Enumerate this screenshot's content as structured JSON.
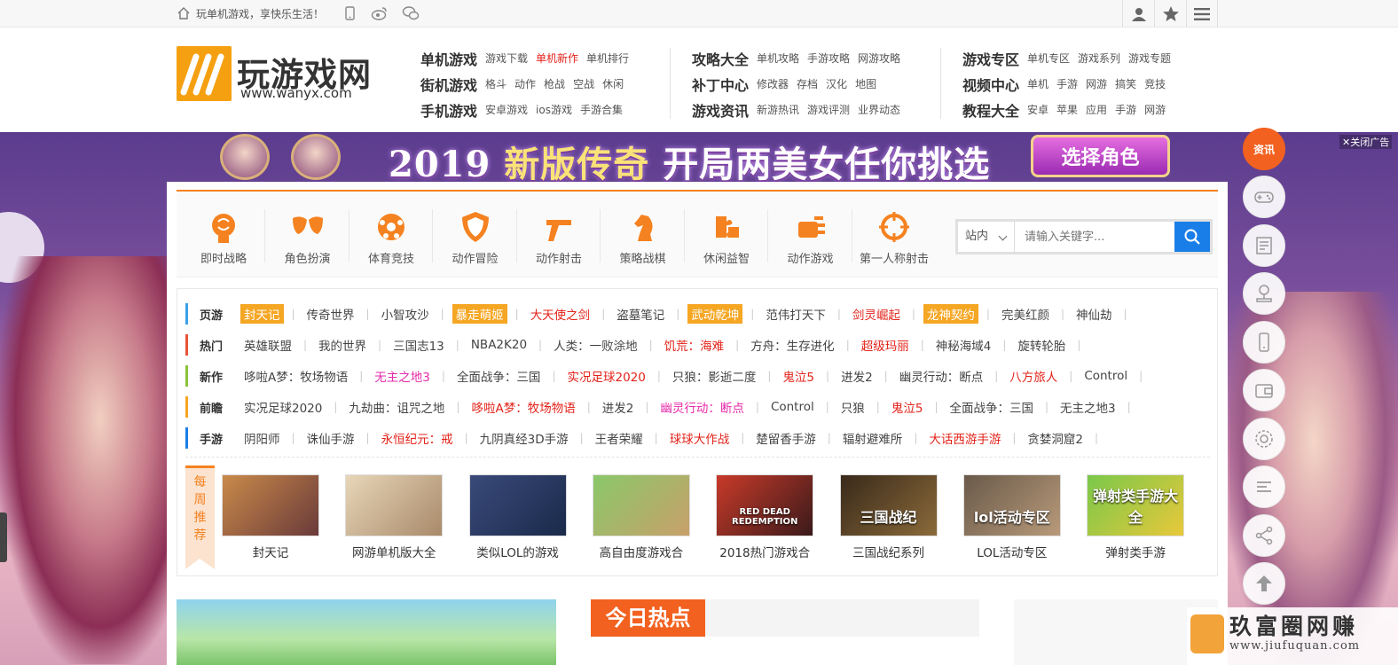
{
  "topbar": {
    "slogan": "玩单机游戏，享快乐生活！",
    "icons": [
      "home-icon",
      "mobile-icon",
      "weibo-icon",
      "wechat-icon",
      "user-icon",
      "star-icon",
      "menu-icon"
    ]
  },
  "logo": {
    "name": "玩游戏网",
    "url": "www.wanyx.com"
  },
  "nav": {
    "col1": [
      {
        "head": "单机游戏",
        "subs": [
          {
            "t": "游戏下载"
          },
          {
            "t": "单机新作",
            "red": true
          },
          {
            "t": "单机排行"
          }
        ]
      },
      {
        "head": "街机游戏",
        "subs": [
          {
            "t": "格斗"
          },
          {
            "t": "动作"
          },
          {
            "t": "枪战"
          },
          {
            "t": "空战"
          },
          {
            "t": "休闲"
          }
        ]
      },
      {
        "head": "手机游戏",
        "subs": [
          {
            "t": "安卓游戏"
          },
          {
            "t": "ios游戏"
          },
          {
            "t": "手游合集"
          }
        ]
      }
    ],
    "col2": [
      {
        "head": "攻略大全",
        "subs": [
          {
            "t": "单机攻略"
          },
          {
            "t": "手游攻略"
          },
          {
            "t": "网游攻略"
          }
        ]
      },
      {
        "head": "补丁中心",
        "subs": [
          {
            "t": "修改器"
          },
          {
            "t": "存档"
          },
          {
            "t": "汉化"
          },
          {
            "t": "地图"
          }
        ]
      },
      {
        "head": "游戏资讯",
        "subs": [
          {
            "t": "新游热讯"
          },
          {
            "t": "游戏评测"
          },
          {
            "t": "业界动态"
          }
        ]
      }
    ],
    "col3": [
      {
        "head": "游戏专区",
        "subs": [
          {
            "t": "单机专区"
          },
          {
            "t": "游戏系列"
          },
          {
            "t": "游戏专题"
          }
        ]
      },
      {
        "head": "视频中心",
        "subs": [
          {
            "t": "单机"
          },
          {
            "t": "手游"
          },
          {
            "t": "网游"
          },
          {
            "t": "搞笑"
          },
          {
            "t": "竞技"
          }
        ]
      },
      {
        "head": "教程大全",
        "subs": [
          {
            "t": "安卓"
          },
          {
            "t": "苹果"
          },
          {
            "t": "应用"
          },
          {
            "t": "手游"
          },
          {
            "t": "网游"
          }
        ]
      }
    ]
  },
  "banner": {
    "year": "2019",
    "text1": "新版传奇",
    "text2": "开局两美女任你挑选",
    "button": "选择角色",
    "close": "关闭广告"
  },
  "categories": [
    "即时战略",
    "角色扮演",
    "体育竞技",
    "动作冒险",
    "动作射击",
    "策略战棋",
    "休闲益智",
    "动作游戏",
    "第一人称射击"
  ],
  "search": {
    "scope": "站内",
    "placeholder": "请输入关键字..."
  },
  "tag_rows": [
    {
      "label": "页游",
      "color": "#3aa0e8",
      "items": [
        {
          "t": "封天记",
          "s": "org"
        },
        {
          "t": "传奇世界"
        },
        {
          "t": "小智攻沙"
        },
        {
          "t": "暴走萌姬",
          "s": "org"
        },
        {
          "t": "大天使之剑",
          "s": "red"
        },
        {
          "t": "盗墓笔记"
        },
        {
          "t": "武动乾坤",
          "s": "org"
        },
        {
          "t": "范伟打天下"
        },
        {
          "t": "剑灵崛起",
          "s": "red"
        },
        {
          "t": "龙神契约",
          "s": "org"
        },
        {
          "t": "完美红颜"
        },
        {
          "t": "神仙劫"
        }
      ]
    },
    {
      "label": "热门",
      "color": "#e8543a",
      "items": [
        {
          "t": "英雄联盟"
        },
        {
          "t": "我的世界"
        },
        {
          "t": "三国志13"
        },
        {
          "t": "NBA2K20"
        },
        {
          "t": "人类：一败涂地"
        },
        {
          "t": "饥荒：海难",
          "s": "red"
        },
        {
          "t": "方舟：生存进化"
        },
        {
          "t": "超级玛丽",
          "s": "red"
        },
        {
          "t": "神秘海域4"
        },
        {
          "t": "旋转轮胎"
        }
      ]
    },
    {
      "label": "新作",
      "color": "#8cc43a",
      "items": [
        {
          "t": "哆啦A梦：牧场物语"
        },
        {
          "t": "无主之地3",
          "s": "pink"
        },
        {
          "t": "全面战争：三国"
        },
        {
          "t": "实况足球2020",
          "s": "red"
        },
        {
          "t": "只狼：影逝二度"
        },
        {
          "t": "鬼泣5",
          "s": "red"
        },
        {
          "t": "进发2"
        },
        {
          "t": "幽灵行动：断点"
        },
        {
          "t": "八方旅人",
          "s": "red"
        },
        {
          "t": "Control"
        }
      ]
    },
    {
      "label": "前瞻",
      "color": "#f5a623",
      "items": [
        {
          "t": "实况足球2020"
        },
        {
          "t": "九劫曲：诅咒之地"
        },
        {
          "t": "哆啦A梦：牧场物语",
          "s": "red"
        },
        {
          "t": "进发2"
        },
        {
          "t": "幽灵行动：断点",
          "s": "pink"
        },
        {
          "t": "Control"
        },
        {
          "t": "只狼"
        },
        {
          "t": "鬼泣5",
          "s": "red"
        },
        {
          "t": "全面战争：三国"
        },
        {
          "t": "无主之地3"
        }
      ]
    },
    {
      "label": "手游",
      "color": "#1a7ee8",
      "items": [
        {
          "t": "阴阳师"
        },
        {
          "t": "诛仙手游"
        },
        {
          "t": "永恒纪元：戒",
          "s": "red"
        },
        {
          "t": "九阴真经3D手游"
        },
        {
          "t": "王者荣耀"
        },
        {
          "t": "球球大作战",
          "s": "red"
        },
        {
          "t": "楚留香手游"
        },
        {
          "t": "辐射避难所"
        },
        {
          "t": "大话西游手游",
          "s": "red"
        },
        {
          "t": "贪婪洞窟2"
        }
      ]
    }
  ],
  "weekly": {
    "label": "每周推荐",
    "items": [
      {
        "label": "封天记",
        "colors": [
          "#c98a4a",
          "#6a3a3a"
        ],
        "overlay": ""
      },
      {
        "label": "网游单机版大全",
        "colors": [
          "#e8d6b8",
          "#a88a6a"
        ],
        "overlay": ""
      },
      {
        "label": "类似LOL的游戏",
        "colors": [
          "#3a4a7a",
          "#1a2a4a"
        ],
        "overlay": ""
      },
      {
        "label": "高自由度游戏合",
        "colors": [
          "#8ac86a",
          "#c8a06a"
        ],
        "overlay": ""
      },
      {
        "label": "2018热门游戏合",
        "colors": [
          "#c83a2a",
          "#3a1a1a"
        ],
        "overlay": "RED DEAD REDEMPTION"
      },
      {
        "label": "三国战纪系列",
        "colors": [
          "#3a2a1a",
          "#8a6a3a"
        ],
        "overlay": "三国战纪"
      },
      {
        "label": "LOL活动专区",
        "colors": [
          "#6a5a4a",
          "#b89a7a"
        ],
        "overlay": "lol活动专区"
      },
      {
        "label": "弹射类手游",
        "colors": [
          "#7ac84a",
          "#e8c83a"
        ],
        "overlay": "弹射类手游大全"
      }
    ]
  },
  "hot": {
    "title": "今日热点"
  },
  "sidenav": {
    "active_label": "资讯",
    "icons": [
      "gamepad-icon",
      "news-icon",
      "joystick-icon",
      "phone-icon",
      "wallet-icon",
      "settings-icon",
      "list-icon",
      "share-icon",
      "back-to-top-icon"
    ]
  },
  "watermark": {
    "line1": "玖富圈网赚",
    "line2": "www.jiufuquan.com"
  },
  "accent": "#f58220"
}
